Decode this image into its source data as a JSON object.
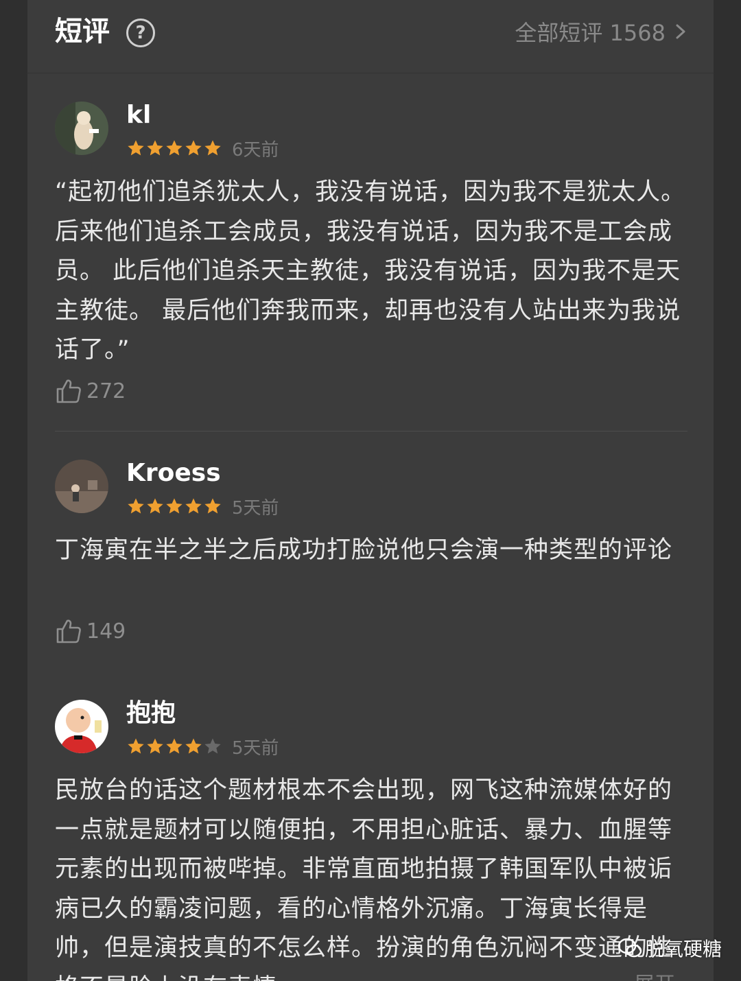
{
  "header": {
    "title": "短评",
    "help_icon": "question-circle-icon",
    "all_reviews_label": "全部短评 1568"
  },
  "colors": {
    "background": "#3c3c3c",
    "star_active": "#f0a030",
    "star_inactive": "#6a6a6a",
    "muted_text": "#8a8a8a"
  },
  "reviews": [
    {
      "username": "kl",
      "rating": 5,
      "time": "6天前",
      "text": "“起初他们追杀犹太人，我没有说话，因为我不是犹太人。 后来他们追杀工会成员，我没有说话，因为我不是工会成员。 此后他们追杀天主教徒，我没有说话，因为我不是天主教徒。 最后他们奔我而来，却再也没有人站出来为我说话了。”",
      "likes": "272"
    },
    {
      "username": "Kroess",
      "rating": 5,
      "time": "5天前",
      "text": "丁海寅在半之半之后成功打脸说他只会演一种类型的评论",
      "likes": "149"
    },
    {
      "username": "抱抱",
      "rating": 4,
      "time": "5天前",
      "text": "民放台的话这个题材根本不会出现，网飞这种流媒体好的一点就是题材可以随便拍，不用担心脏话、暴力、血腥等元素的出现而被哔掉。非常直面地拍摄了韩国军队中被诟病已久的霸凌问题，看的心情格外沉痛。丁海寅长得是帅，但是演技真的不怎么样。扮演的角色沉闷不变通的性格不是脸上没有表情",
      "expand_label": "展开"
    }
  ],
  "watermark": {
    "text": "脱氧硬糖",
    "icon": "wechat-icon"
  }
}
